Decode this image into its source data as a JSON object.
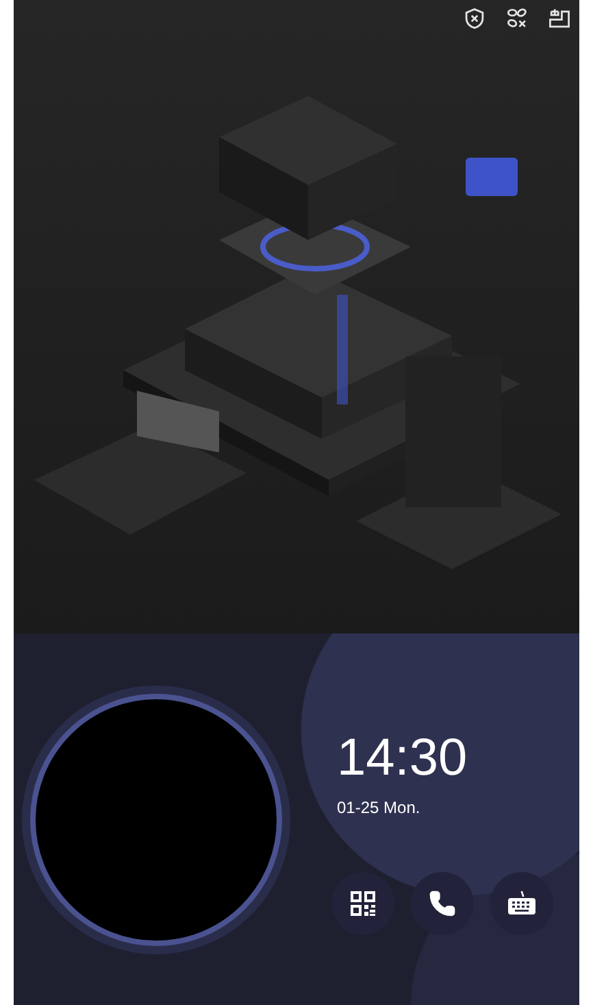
{
  "status_icons": [
    {
      "kind": "shield"
    },
    {
      "kind": "link"
    },
    {
      "kind": "tray"
    }
  ],
  "clock": {
    "time": "14:30",
    "date": "01-25 Mon."
  },
  "actions": [
    {
      "kind": "qr"
    },
    {
      "kind": "call"
    },
    {
      "kind": "keyboard"
    }
  ]
}
